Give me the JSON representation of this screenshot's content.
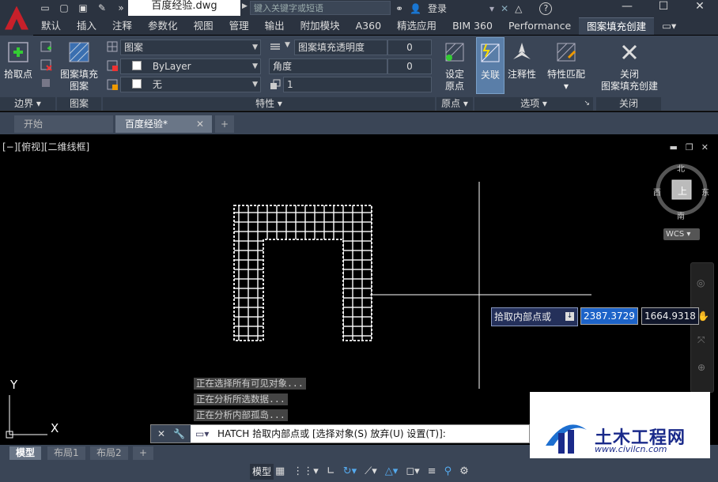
{
  "titlebar": {
    "document_title": "百度经验.dwg",
    "search_placeholder": "键入关键字或短语",
    "login_label": "登录",
    "help_label": "?"
  },
  "ribbon_tabs": [
    "默认",
    "插入",
    "注释",
    "参数化",
    "视图",
    "管理",
    "输出",
    "附加模块",
    "A360",
    "精选应用",
    "BIM 360",
    "Performance",
    "图案填充创建"
  ],
  "ribbon": {
    "pick_point": "拾取点",
    "boundary_title": "边界",
    "pattern_btn_l1": "图案填充",
    "pattern_btn_l2": "图案",
    "pattern_title": "图案",
    "pattern_combo": "图案",
    "bylayer_combo": "ByLayer",
    "none_combo": "无",
    "transparency_label": "图案填充透明度",
    "transparency_value": "0",
    "angle_label": "角度",
    "angle_value": "0",
    "scale_value": "1",
    "properties_title": "特性",
    "set_origin_l1": "设定",
    "set_origin_l2": "原点",
    "origin_title": "原点",
    "associative": "关联",
    "annotative": "注释性",
    "match_props": "特性匹配",
    "options_title": "选项",
    "close_l1": "关闭",
    "close_l2": "图案填充创建",
    "close_title": "关闭"
  },
  "file_tabs": {
    "start": "开始",
    "current": "百度经验*",
    "add": "+"
  },
  "viewport": {
    "label": "[−][俯视][二维线框]"
  },
  "viewcube": {
    "north": "北",
    "south": "南",
    "east": "东",
    "west": "西",
    "face": "上",
    "wcs": "WCS"
  },
  "messages": [
    "正在选择所有可见对象...",
    "正在分析所选数据...",
    "正在分析内部孤岛..."
  ],
  "command": {
    "text": "HATCH 拾取内部点或 [选择对象(S) 放弃(U) 设置(T)]:"
  },
  "tooltip": {
    "prompt": "拾取内部点或",
    "x": "2387.3729",
    "y": "1664.9318"
  },
  "ucs": {
    "x": "X",
    "y": "Y"
  },
  "layout_tabs": [
    "模型",
    "布局1",
    "布局2"
  ],
  "status": {
    "model": "模型"
  },
  "watermark": {
    "title": "土木工程网",
    "url": "www.civilcn.com"
  },
  "colors": {
    "ribbon": "#3a4556",
    "titlebar": "#2b3340",
    "canvas": "#000000",
    "accent": "#1d63c8"
  }
}
